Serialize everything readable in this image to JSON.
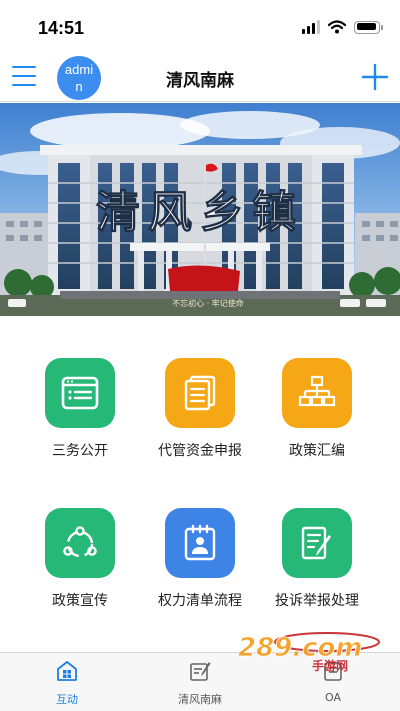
{
  "status_bar": {
    "time": "14:51"
  },
  "nav": {
    "avatar_text": "admin",
    "title": "清风南麻"
  },
  "banner": {
    "calligraphy": "清风乡镇",
    "caption": "不忘初心 · 牢记使命"
  },
  "grid": {
    "items": [
      {
        "label": "三务公开",
        "icon": "window-list-icon",
        "color": "#25b877"
      },
      {
        "label": "代管资金申报",
        "icon": "documents-icon",
        "color": "#f5a716"
      },
      {
        "label": "政策汇编",
        "icon": "org-chart-icon",
        "color": "#f5a716"
      },
      {
        "label": "政策宣传",
        "icon": "share-circle-icon",
        "color": "#25b877"
      },
      {
        "label": "权力清单流程",
        "icon": "calendar-person-icon",
        "color": "#3e83e6"
      },
      {
        "label": "投诉举报处理",
        "icon": "edit-note-icon",
        "color": "#25b877"
      }
    ]
  },
  "tabs": [
    {
      "label": "互动",
      "icon": "grid-home-icon",
      "active": true
    },
    {
      "label": "清风南麻",
      "icon": "sign-pen-icon",
      "active": false
    },
    {
      "label": "OA",
      "icon": "oa-icon",
      "active": false
    }
  ],
  "watermark": {
    "text": "289.com",
    "sub": "手游网"
  },
  "colors": {
    "accent": "#1a8cf0",
    "green": "#25b877",
    "orange": "#f5a716",
    "blue": "#3e83e6"
  }
}
